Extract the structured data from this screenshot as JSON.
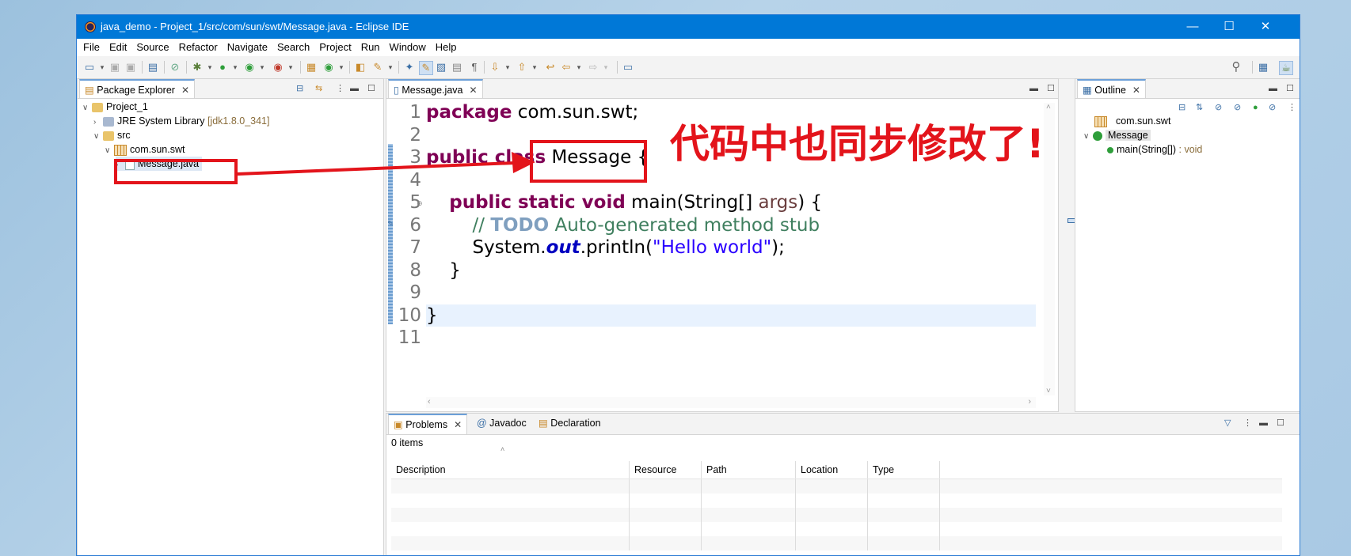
{
  "window": {
    "title": "java_demo - Project_1/src/com/sun/swt/Message.java - Eclipse IDE",
    "controls": {
      "minimize": "—",
      "maximize": "☐",
      "close": "✕"
    }
  },
  "menu": [
    "File",
    "Edit",
    "Source",
    "Refactor",
    "Navigate",
    "Search",
    "Project",
    "Run",
    "Window",
    "Help"
  ],
  "package_explorer": {
    "tab_label": "Package Explorer",
    "tree": [
      {
        "label": "Project_1",
        "expanded": true
      },
      {
        "label": "JRE System Library",
        "decoration": "[jdk1.8.0_341]"
      },
      {
        "label": "src",
        "expanded": true
      },
      {
        "label": "com.sun.swt",
        "expanded": true
      },
      {
        "label": "Message.java",
        "selected": true
      }
    ]
  },
  "editor": {
    "tab_label": "Message.java",
    "line_numbers": [
      "1",
      "2",
      "3",
      "4",
      "5",
      "6",
      "7",
      "8",
      "9",
      "10",
      "11"
    ],
    "lines": {
      "l1": {
        "kw": "package",
        "rest": " com.sun.swt;"
      },
      "l3": {
        "kw": "public class",
        "rest": " Message {"
      },
      "l5": {
        "kw": "public static void",
        "name": " main(String[] ",
        "arg": "args",
        "end": ") {"
      },
      "l6": {
        "comment": "// ",
        "todo": "TODO",
        "comment2": " Auto-generated method stub"
      },
      "l7": {
        "pre": "System.",
        "field": "out",
        "mid": ".println(",
        "str": "\"Hello world\"",
        "end": ");"
      },
      "l8": "}",
      "l10": "}"
    }
  },
  "outline": {
    "tab_label": "Outline",
    "items": [
      {
        "label": "com.sun.swt"
      },
      {
        "label": "Message"
      },
      {
        "label": "main(String[])",
        "type": " : void"
      }
    ]
  },
  "bottom": {
    "tabs": [
      "Problems",
      "Javadoc",
      "Declaration"
    ],
    "count": "0 items",
    "columns": [
      "Description",
      "Resource",
      "Path",
      "Location",
      "Type"
    ]
  },
  "annotation": {
    "text": "代码中也同步修改了!",
    "color": "#e3141b"
  }
}
